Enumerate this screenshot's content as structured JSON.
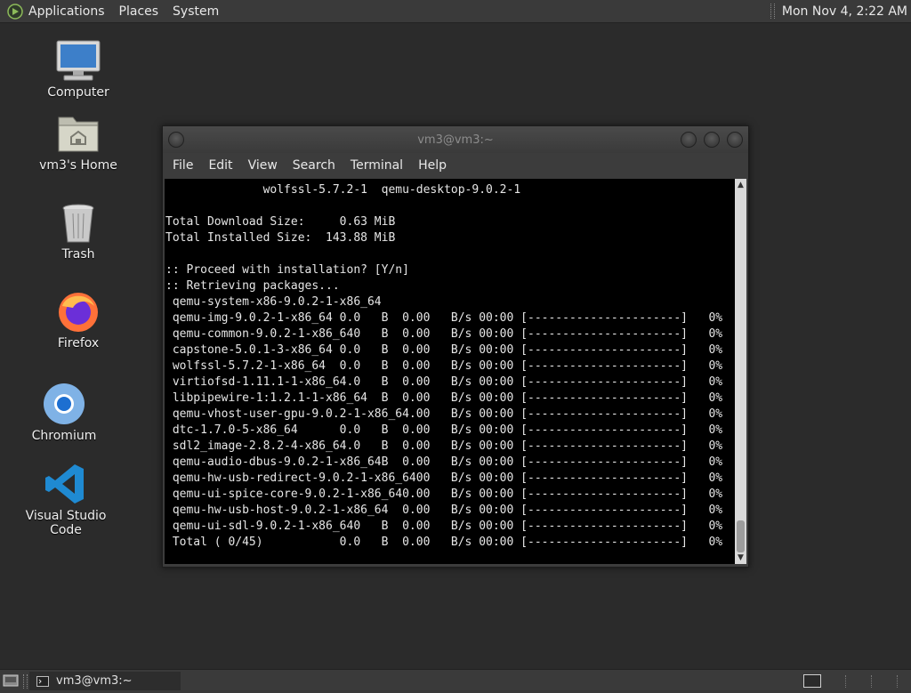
{
  "top_panel": {
    "menus": [
      "Applications",
      "Places",
      "System"
    ],
    "clock": "Mon Nov  4,  2:22 AM"
  },
  "desktop_icons": [
    {
      "label": "Computer",
      "icon": "computer-icon"
    },
    {
      "label": "vm3's Home",
      "icon": "home-folder-icon"
    },
    {
      "label": "Trash",
      "icon": "trash-icon"
    },
    {
      "label": "Firefox",
      "icon": "firefox-icon"
    },
    {
      "label": "Chromium",
      "icon": "chromium-icon"
    },
    {
      "label": "Visual Studio Code",
      "icon": "vscode-icon"
    }
  ],
  "terminal": {
    "title": "vm3@vm3:~",
    "menus": [
      "File",
      "Edit",
      "View",
      "Search",
      "Terminal",
      "Help"
    ],
    "lines": [
      "              wolfssl-5.7.2-1  qemu-desktop-9.0.2-1",
      "",
      "Total Download Size:     0.63 MiB",
      "Total Installed Size:  143.88 MiB",
      "",
      ":: Proceed with installation? [Y/n]",
      ":: Retrieving packages...",
      " qemu-system-x86-9.0.2-1-x86_64",
      " qemu-img-9.0.2-1-x86_64 0.0   B  0.00   B/s 00:00 [----------------------]   0%",
      " qemu-common-9.0.2-1-x86_640   B  0.00   B/s 00:00 [----------------------]   0%",
      " capstone-5.0.1-3-x86_64 0.0   B  0.00   B/s 00:00 [----------------------]   0%",
      " wolfssl-5.7.2-1-x86_64  0.0   B  0.00   B/s 00:00 [----------------------]   0%",
      " virtiofsd-1.11.1-1-x86_64.0   B  0.00   B/s 00:00 [----------------------]   0%",
      " libpipewire-1:1.2.1-1-x86_64  B  0.00   B/s 00:00 [----------------------]   0%",
      " qemu-vhost-user-gpu-9.0.2-1-x86_64.00   B/s 00:00 [----------------------]   0%",
      " dtc-1.7.0-5-x86_64      0.0   B  0.00   B/s 00:00 [----------------------]   0%",
      " sdl2_image-2.8.2-4-x86_64.0   B  0.00   B/s 00:00 [----------------------]   0%",
      " qemu-audio-dbus-9.0.2-1-x86_64B  0.00   B/s 00:00 [----------------------]   0%",
      " qemu-hw-usb-redirect-9.0.2-1-x86_6400   B/s 00:00 [----------------------]   0%",
      " qemu-ui-spice-core-9.0.2-1-x86_640.00   B/s 00:00 [----------------------]   0%",
      " qemu-hw-usb-host-9.0.2-1-x86_64  0.00   B/s 00:00 [----------------------]   0%",
      " qemu-ui-sdl-9.0.2-1-x86_640   B  0.00   B/s 00:00 [----------------------]   0%",
      " Total ( 0/45)           0.0   B  0.00   B/s 00:00 [----------------------]   0%"
    ]
  },
  "taskbar": {
    "task_label": "vm3@vm3:~"
  }
}
